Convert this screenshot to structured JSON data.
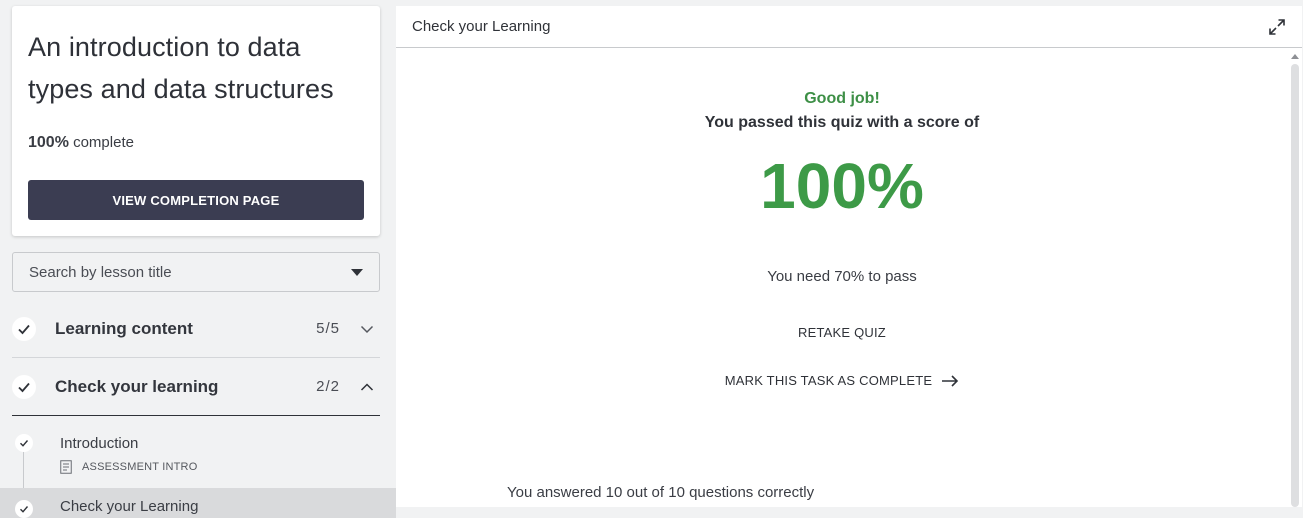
{
  "course": {
    "title": "An introduction to data types and data structures",
    "progress_value": "100%",
    "progress_suffix": "complete",
    "completion_button": "VIEW COMPLETION PAGE"
  },
  "search": {
    "placeholder": "Search by lesson title"
  },
  "sections": [
    {
      "title": "Learning content",
      "count": "5/5",
      "expanded": false
    },
    {
      "title": "Check your learning",
      "count": "2/2",
      "expanded": true
    }
  ],
  "lessons": [
    {
      "title": "Introduction",
      "type": "ASSESSMENT INTRO"
    },
    {
      "title": "Check your Learning",
      "type": ""
    }
  ],
  "panel": {
    "title": "Check your Learning",
    "good_job": "Good job!",
    "passed_text": "You passed this quiz with a score of",
    "score": "100%",
    "need_text": "You need 70% to pass",
    "retake": "RETAKE QUIZ",
    "mark_complete": "MARK THIS TASK AS COMPLETE",
    "answered": "You answered 10 out of 10 questions correctly"
  },
  "colors": {
    "accent_green": "#3d9a47",
    "button_dark": "#3b3d52"
  }
}
